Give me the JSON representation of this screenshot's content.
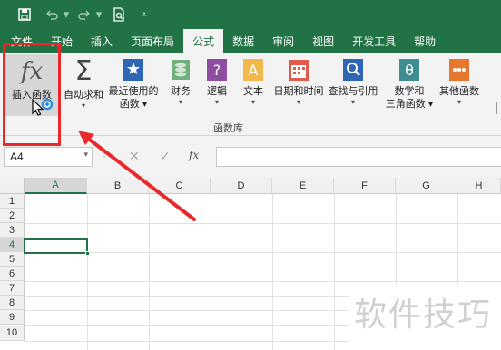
{
  "quick_access": {
    "save_icon": "save-icon",
    "undo_icon": "undo-icon",
    "redo_icon": "redo-icon",
    "preview_icon": "print-preview-icon",
    "more_icon": "customize-icon"
  },
  "tabs": [
    "文件",
    "开始",
    "插入",
    "页面布局",
    "公式",
    "数据",
    "审阅",
    "视图",
    "开发工具",
    "帮助"
  ],
  "active_tab": "公式",
  "ribbon": {
    "insert_function": "插入函数",
    "autosum": "自动求和",
    "recent_1": "最近使用的",
    "recent_2": "函数",
    "financial": "财务",
    "logical": "逻辑",
    "text": "文本",
    "datetime": "日期和时间",
    "lookup": "查找与引用",
    "math_1": "数学和",
    "math_2": "三角函数",
    "more": "其他函数",
    "group_label": "函数库"
  },
  "formula_bar": {
    "name_box": "A4",
    "cancel": "✕",
    "enter": "✓",
    "fx": "fx",
    "formula": ""
  },
  "columns": [
    "A",
    "B",
    "C",
    "D",
    "E",
    "F",
    "G",
    "H"
  ],
  "rows": [
    "1",
    "2",
    "3",
    "4",
    "5",
    "6",
    "7",
    "8",
    "9",
    "10"
  ],
  "selected_cell": "A4",
  "watermark": "软件技巧",
  "colors": {
    "accent": "#217346",
    "annotation": "#e8282b"
  }
}
